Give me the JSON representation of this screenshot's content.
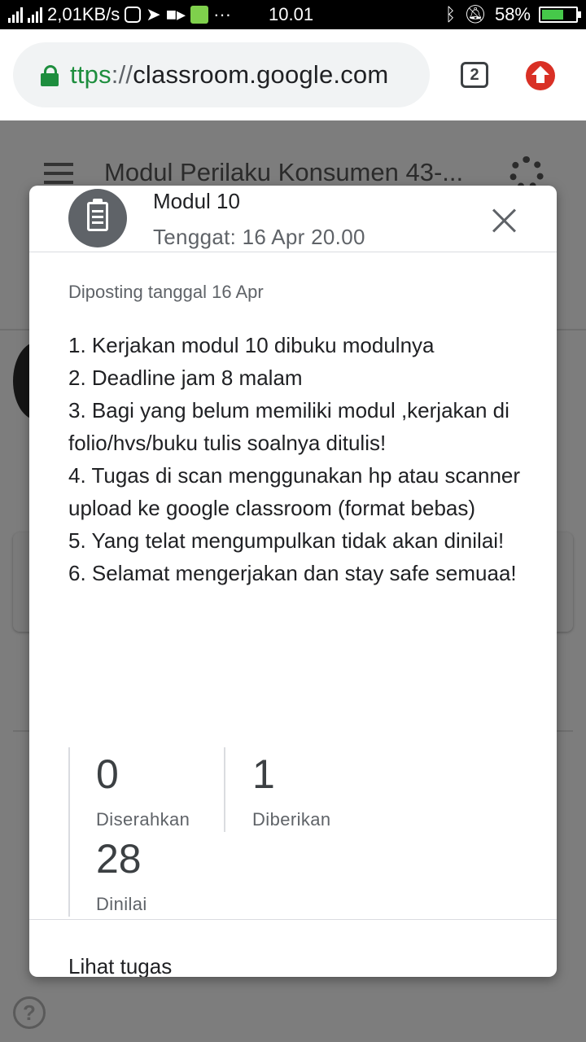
{
  "status_bar": {
    "network_speed": "2,01KB/s",
    "time": "10.01",
    "battery_percent": "58%",
    "icons": [
      "signal-icon",
      "signal-h-icon",
      "instagram-icon",
      "telegram-icon",
      "video-icon",
      "android-icon",
      "more-dots-icon",
      "bluetooth-icon",
      "silent-bell-icon",
      "battery-charging-icon"
    ]
  },
  "browser": {
    "url_scheme": "ttps",
    "url_sep": "://",
    "url_host": "classroom.google.com",
    "tab_count": "2"
  },
  "background": {
    "class_title": "Modul Perilaku Konsumen 43-..."
  },
  "dialog": {
    "title": "Modul 10",
    "due": "Tenggat: 16 Apr 20.00",
    "posted": "Diposting tanggal 16 Apr",
    "instructions": [
      "1. Kerjakan modul 10 dibuku modulnya",
      "2. Deadline jam 8 malam",
      "3. Bagi yang belum memiliki modul ,kerjakan di folio/hvs/buku tulis soalnya ditulis!",
      "4. Tugas di scan menggunakan hp atau scanner upload ke google classroom (format bebas)",
      "5. Yang telat mengumpulkan tidak akan dinilai!",
      "6. Selamat mengerjakan dan stay safe semuaa!"
    ],
    "stats": {
      "submitted": {
        "value": "0",
        "label": "Diserahkan"
      },
      "assigned": {
        "value": "1",
        "label": "Diberikan"
      },
      "graded": {
        "value": "28",
        "label": "Dinilai"
      }
    },
    "view_link": "Lihat tugas"
  },
  "colors": {
    "secure_green": "#1e8e3e",
    "update_red": "#d93025",
    "scrim": "#7d7d7d"
  }
}
